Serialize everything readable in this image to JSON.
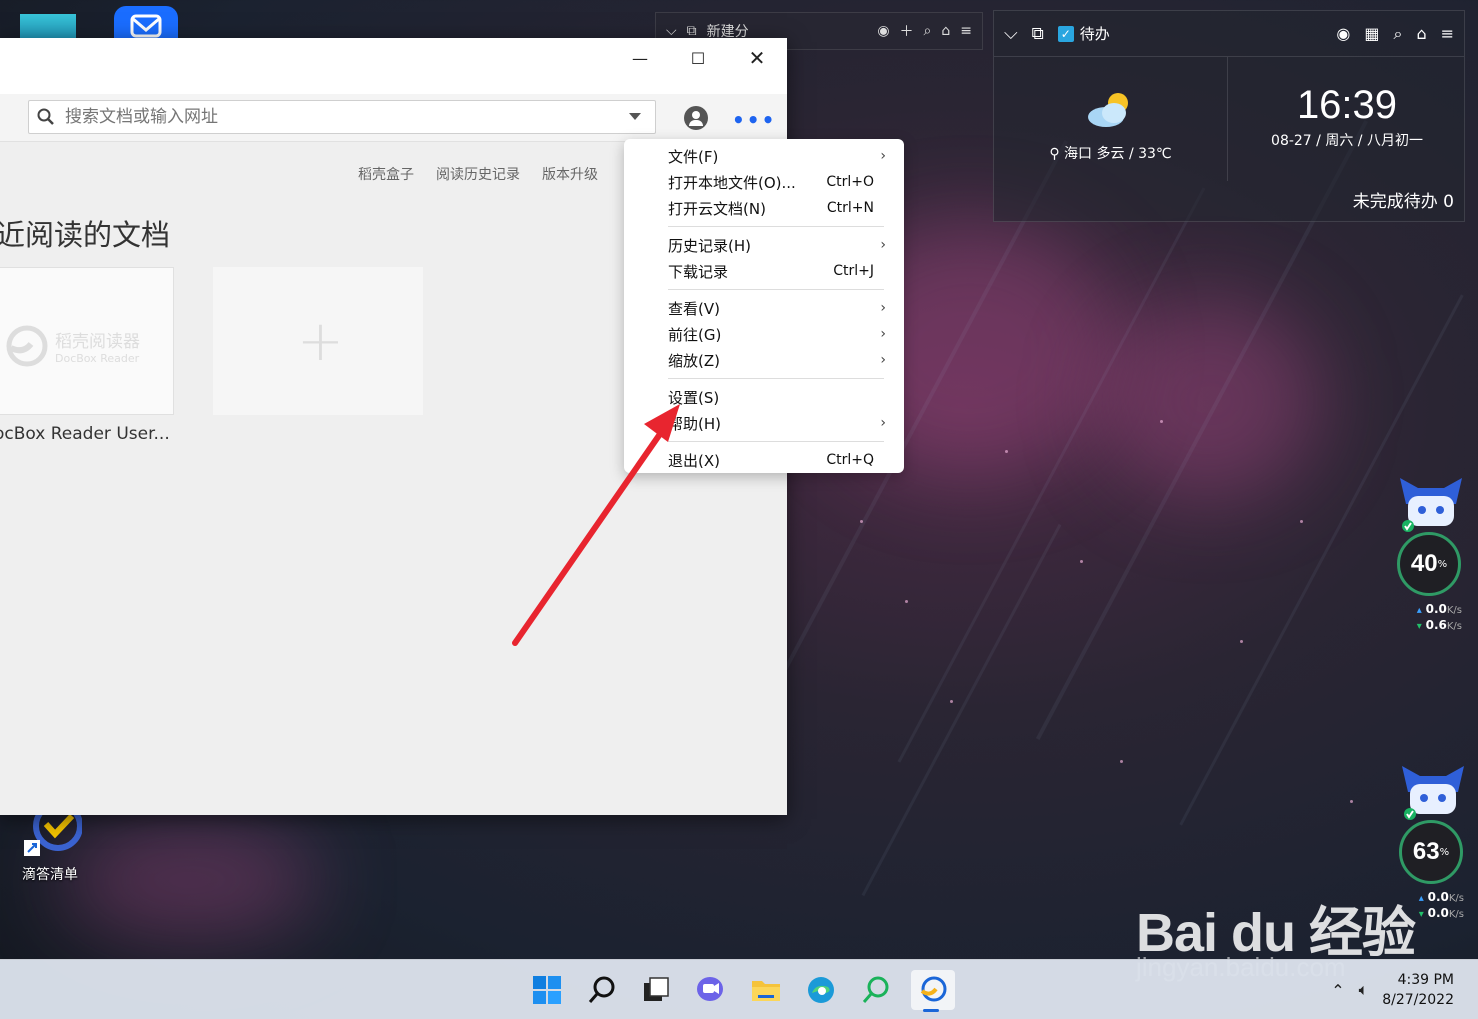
{
  "window": {
    "search_placeholder": "搜索文档或输入网址",
    "links": [
      "稻壳盒子",
      "阅读历史记录",
      "版本升级"
    ],
    "section_title": "近阅读的文档",
    "doc_name": "ocBox Reader User...",
    "doc_logo_title": "稻壳阅读器",
    "doc_logo_sub": "DocBox Reader",
    "add_label": "+"
  },
  "menu": {
    "groups": [
      [
        {
          "label": "文件(F)",
          "shortcut": "",
          "submenu": true
        },
        {
          "label": "打开本地文件(O)...",
          "shortcut": "Ctrl+O",
          "submenu": false
        },
        {
          "label": "打开云文档(N)",
          "shortcut": "Ctrl+N",
          "submenu": false
        }
      ],
      [
        {
          "label": "历史记录(H)",
          "shortcut": "",
          "submenu": true
        },
        {
          "label": "下载记录",
          "shortcut": "Ctrl+J",
          "submenu": false
        }
      ],
      [
        {
          "label": "查看(V)",
          "shortcut": "",
          "submenu": true
        },
        {
          "label": "前往(G)",
          "shortcut": "",
          "submenu": true
        },
        {
          "label": "缩放(Z)",
          "shortcut": "",
          "submenu": true
        }
      ],
      [
        {
          "label": "设置(S)",
          "shortcut": "",
          "submenu": false
        },
        {
          "label": "帮助(H)",
          "shortcut": "",
          "submenu": true
        }
      ],
      [
        {
          "label": "退出(X)",
          "shortcut": "Ctrl+Q",
          "submenu": false
        }
      ]
    ]
  },
  "widget_small": {
    "label": "新建分"
  },
  "widget": {
    "todo_label": "待办",
    "location": "海口",
    "weather": "多云 / 33℃",
    "time": "16:39",
    "date": "08-27 / 周六 / 八月初一",
    "pending": "未完成待办 0"
  },
  "monitors": [
    {
      "percent": "40",
      "unit": "%",
      "up": "0.0",
      "down": "0.6",
      "speed_unit": "K/s"
    },
    {
      "percent": "63",
      "unit": "%",
      "up": "0.0",
      "down": "0.0",
      "speed_unit": "K/s"
    }
  ],
  "desktop": {
    "icon_label": "滴答清单"
  },
  "watermark": {
    "brand": "Bai du 经验",
    "url": "jingyan.baidu.com"
  },
  "taskbar": {
    "icons": [
      "windows-start-icon",
      "search-icon",
      "task-view-icon",
      "teams-chat-icon",
      "file-explorer-icon",
      "edge-icon",
      "search-app-icon",
      "docbox-reader-icon"
    ],
    "time": "4:39 PM",
    "date": "8/27/2022"
  },
  "colors": {
    "accent": "#1e64f0",
    "arrow": "#e8252f",
    "taskbar": "#dce2ec"
  }
}
